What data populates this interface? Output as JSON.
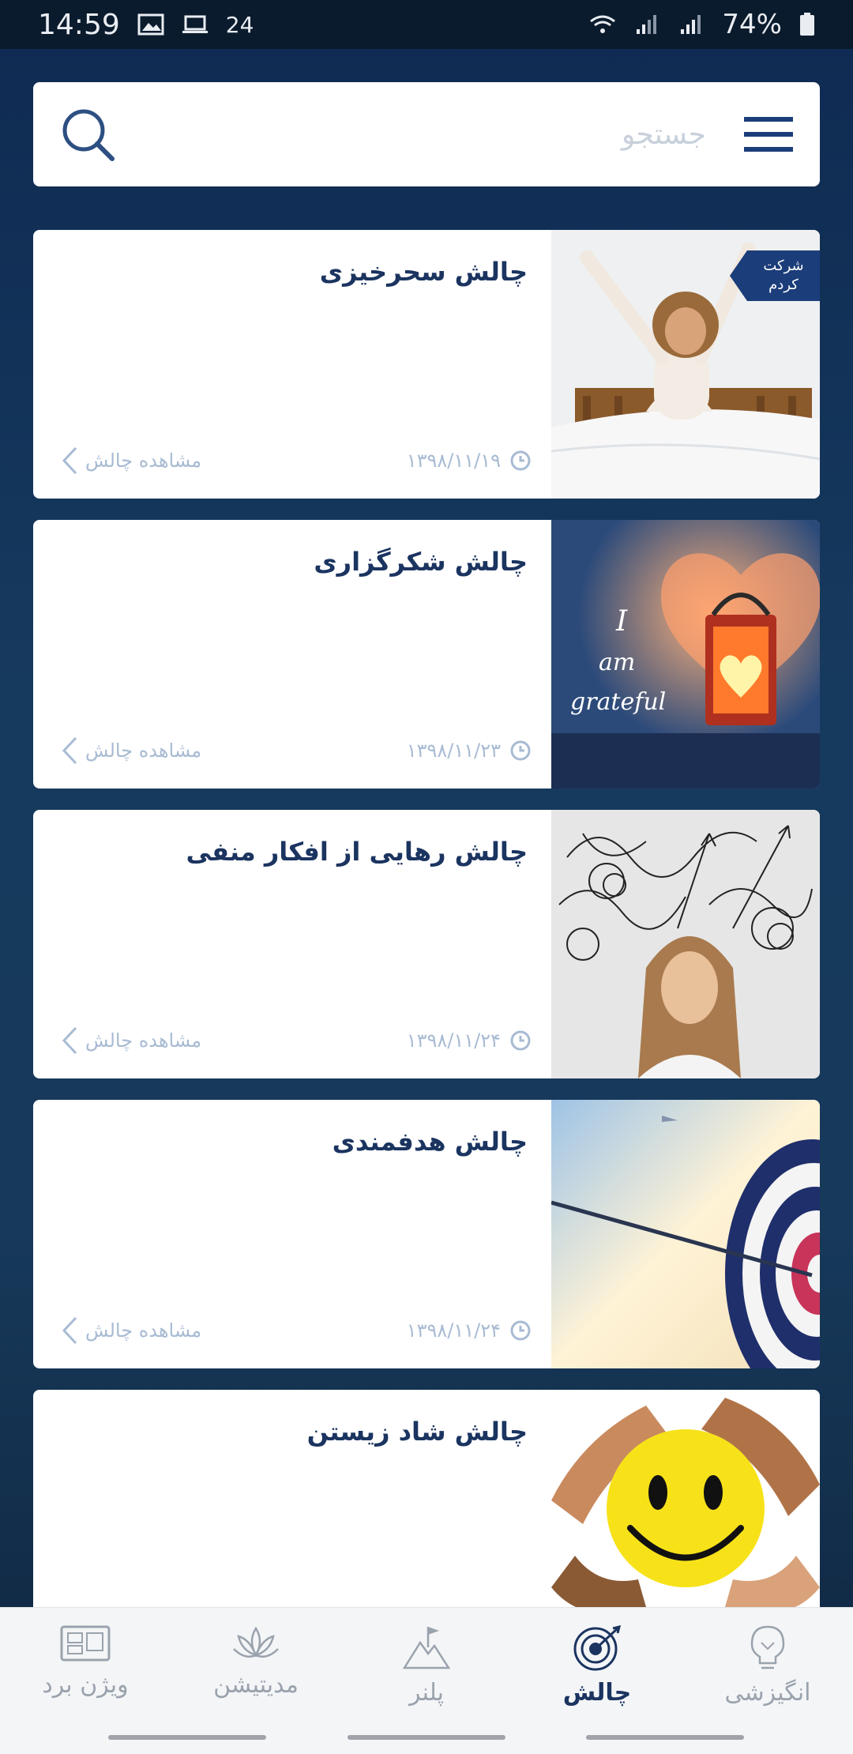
{
  "status": {
    "time": "14:59",
    "notif_count": "24",
    "battery": "74%"
  },
  "search": {
    "placeholder": "جستجو"
  },
  "challenges": [
    {
      "title": "چالش سحرخیزی",
      "date": "۱۳۹۸/۱۱/۱۹",
      "view_label": "مشاهده چالش",
      "badge": [
        "شرکت",
        "کردم"
      ],
      "image": "woman-waking-up"
    },
    {
      "title": "چالش شکرگزاری",
      "date": "۱۳۹۸/۱۱/۲۳",
      "view_label": "مشاهده چالش",
      "image": "lantern-heart",
      "image_text": [
        "I",
        "am",
        "grateful"
      ]
    },
    {
      "title": "چالش رهایی از افکار منفی",
      "date": "۱۳۹۸/۱۱/۲۴",
      "view_label": "مشاهده چالش",
      "image": "woman-tangled-thoughts"
    },
    {
      "title": "چالش هدفمندی",
      "date": "۱۳۹۸/۱۱/۲۴",
      "view_label": "مشاهده چالش",
      "image": "arrow-target"
    },
    {
      "title": "چالش شاد زیستن",
      "image": "smiley-ball-hands"
    }
  ],
  "nav": [
    {
      "label": "ویژن برد",
      "icon": "vision-board-icon"
    },
    {
      "label": "مدیتیشن",
      "icon": "lotus-icon"
    },
    {
      "label": "پلنر",
      "icon": "mountain-flag-icon"
    },
    {
      "label": "چالش",
      "icon": "target-icon",
      "active": true
    },
    {
      "label": "انگیزشی",
      "icon": "bulb-icon"
    }
  ],
  "colors": {
    "accent": "#1b3460",
    "muted": "#a8bbd3",
    "background": "#163a5e"
  }
}
